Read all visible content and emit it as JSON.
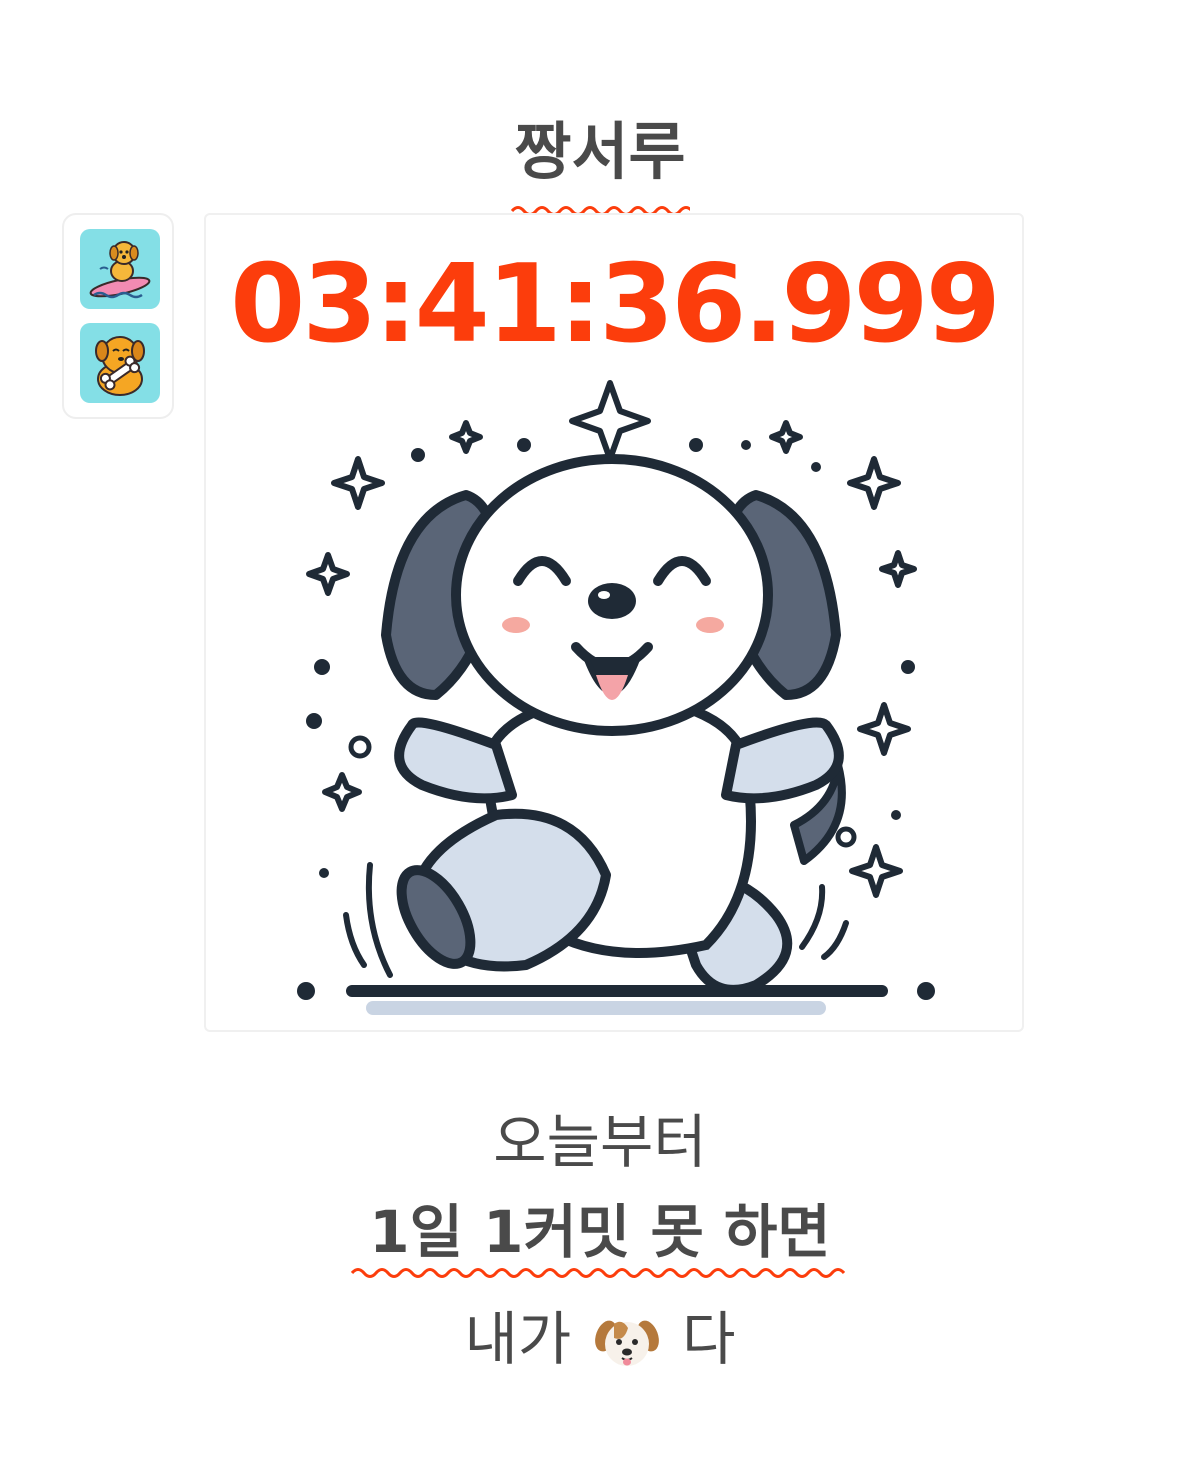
{
  "header": {
    "title": "짱서루"
  },
  "sidebar": {
    "items": [
      {
        "icon": "surfing-dog-icon"
      },
      {
        "icon": "dog-with-bone-icon"
      }
    ]
  },
  "timer": {
    "value": "03:41:36.999",
    "color": "#fc3d0c"
  },
  "illustration": {
    "icon": "happy-dancing-dog-illustration"
  },
  "caption": {
    "line1": "오늘부터",
    "line2": "1일 1커밋 못 하면",
    "line3_before": "내가",
    "line3_emoji": "dog-face-icon",
    "line3_after": "다"
  },
  "colors": {
    "text": "#4a4a4a",
    "accent": "#fc3d0c",
    "icon_bg": "#84dfe6"
  }
}
